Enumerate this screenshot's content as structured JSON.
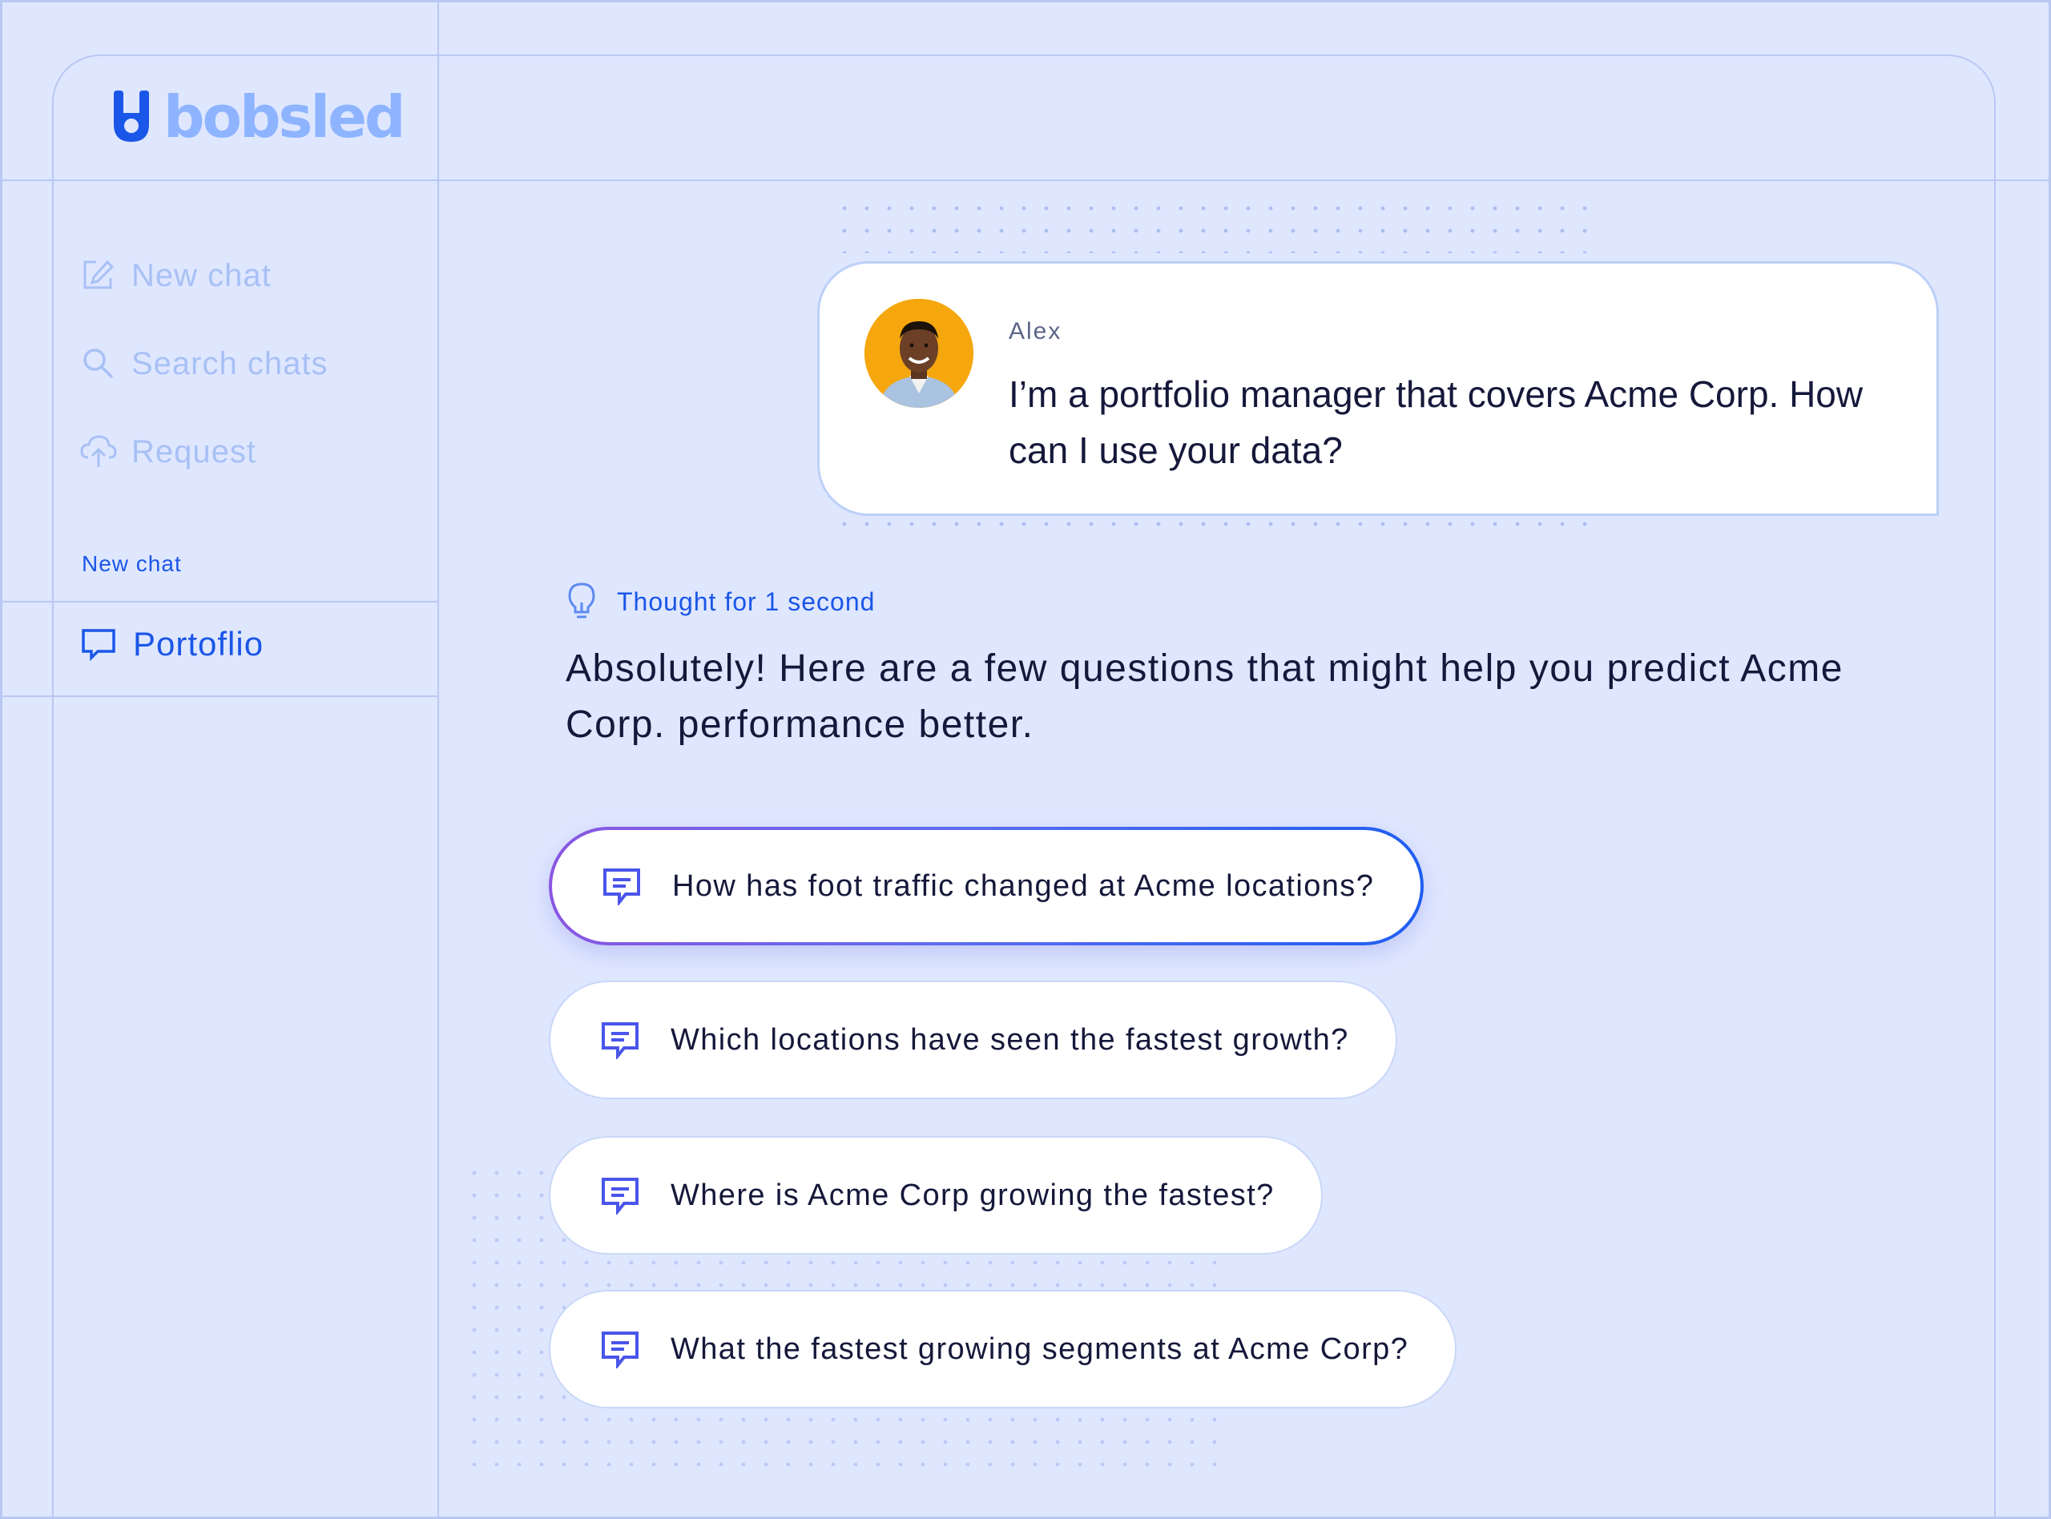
{
  "brand": {
    "name": "bobsled",
    "accent": "#1a56e8",
    "logo_color": "#8eb4ff"
  },
  "sidebar": {
    "items": [
      {
        "label": "New chat",
        "icon": "new-chat-icon"
      },
      {
        "label": "Search chats",
        "icon": "search-icon"
      },
      {
        "label": "Request",
        "icon": "request-icon"
      }
    ],
    "section_label": "New chat",
    "chats": [
      {
        "label": "Portoflio",
        "icon": "chat-bubble-icon"
      }
    ]
  },
  "conversation": {
    "user": {
      "name": "Alex",
      "message": "I’m a portfolio manager that covers Acme Corp. How can I use your data?"
    },
    "thought": {
      "label": "Thought for 1 second",
      "icon": "lightbulb-icon"
    },
    "answer": "Absolutely! Here are a few questions that might help you predict Acme Corp. performance better.",
    "suggestions": [
      {
        "label": "How has foot traffic changed at Acme locations?"
      },
      {
        "label": "Which locations have seen the fastest growth?"
      },
      {
        "label": "Where is Acme Corp growing the fastest?"
      },
      {
        "label": "What the fastest growing segments at Acme Corp?"
      }
    ]
  }
}
